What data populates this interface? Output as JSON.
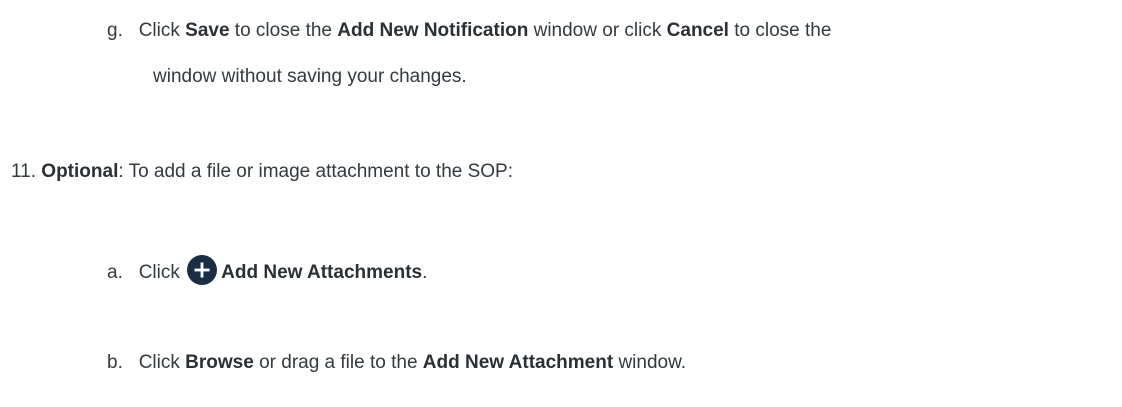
{
  "step_g": {
    "marker": "g.",
    "t1": "Click ",
    "b1": "Save",
    "t2": " to close the ",
    "b2": "Add New Notification",
    "t3": " window or click ",
    "b3": "Cancel",
    "t4": " to close the",
    "line2": "window without saving your changes."
  },
  "step_11": {
    "marker": "11.",
    "b1": "Optional",
    "t1": ": To add a file or image attachment to the SOP:"
  },
  "step_a": {
    "marker": "a.",
    "t1": "Click ",
    "icon": "plus-circle-icon",
    "b1": "Add New Attachments",
    "t2": "."
  },
  "step_b": {
    "marker": "b.",
    "t1": "Click ",
    "b1": "Browse",
    "t2": " or drag a file to the ",
    "b2": "Add New Attachment",
    "t3": " window."
  },
  "colors": {
    "text": "#333a3f",
    "icon": "#1b2f44"
  }
}
